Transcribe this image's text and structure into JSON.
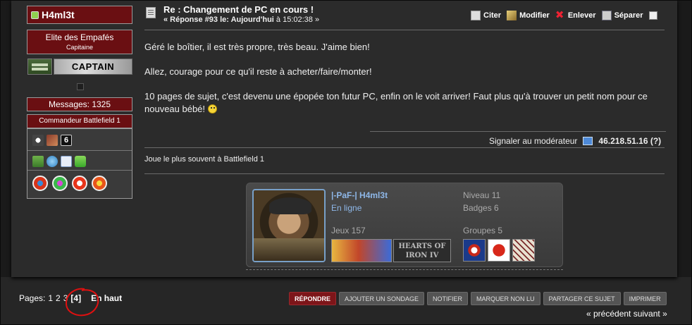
{
  "author": {
    "username": "H4ml3t",
    "group": "Elite des Empafés",
    "rank": "Capitaine",
    "rank_label": "CAPTAIN",
    "messages": "Messages: 1325",
    "title": "Commandeur Battlefield 1"
  },
  "post": {
    "title": "Re : Changement de PC en cours !",
    "reply_prefix": "« Réponse #93 le: Aujourd'hui",
    "time_suffix": "à 15:02:38 »",
    "actions": {
      "quote": "Citer",
      "edit": "Modifier",
      "remove": "Enlever",
      "split": "Séparer"
    },
    "paragraphs": [
      "Géré le boîtier, il est très propre, très beau. J'aime bien!",
      "Allez, courage pour ce qu'il reste à acheter/faire/monter!",
      "10 pages de sujet, c'est devenu une épopée ton futur PC, enfin on le voit arriver! Faut plus qu'à trouver un petit nom pour ce nouveau bébé!"
    ],
    "report": "Signaler au modérateur",
    "ip": "46.218.51.16 (?)",
    "signature": "Joue le plus souvent à Battlefield 1"
  },
  "profile": {
    "name": "|-PaF-| H4ml3t",
    "status": "En ligne",
    "level": "Niveau 11",
    "badges": "Badges 6",
    "games": "Jeux 157",
    "groups": "Groupes 5",
    "game2_text": "HEARTS OF IRON IV"
  },
  "pagination": {
    "label": "Pages:",
    "pages": [
      "1",
      "2",
      "3"
    ],
    "current": "[4]",
    "top": "En haut"
  },
  "buttons": {
    "reply": "RÉPONDRE",
    "poll": "AJOUTER UN SONDAGE",
    "notify": "NOTIFIER",
    "unread": "MARQUER NON LU",
    "share": "PARTAGER CE SUJET",
    "print": "IMPRIMER"
  },
  "nav": {
    "text": "« précédent suivant »"
  },
  "colors": {
    "accent_red": "#6a0f12",
    "link_blue": "#8eb7e8",
    "annotation_red": "#e01010"
  }
}
